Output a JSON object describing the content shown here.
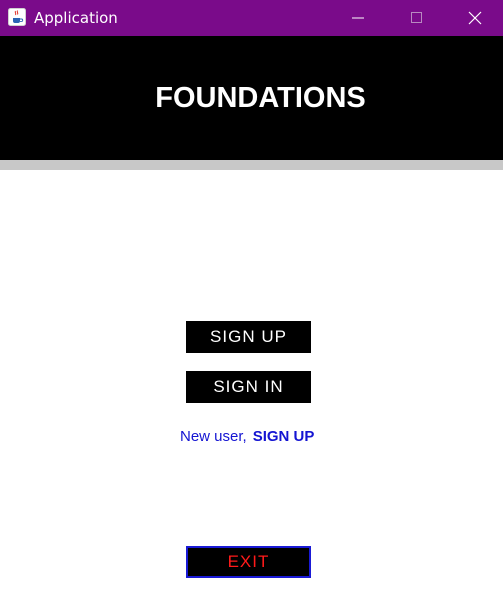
{
  "window": {
    "title": "Application",
    "icon": "java-cup-icon",
    "controls": {
      "minimize": "minimize-icon",
      "maximize": "maximize-icon",
      "close": "close-icon"
    },
    "titlebar_color": "#7a0b8a"
  },
  "header": {
    "title": "FOUNDATIONS",
    "background": "#000000"
  },
  "buttons": {
    "sign_up": "SIGN UP",
    "sign_in": "SIGN IN",
    "exit": "EXIT"
  },
  "new_user": {
    "label": "New user,",
    "link": "SIGN UP",
    "color": "#1414d2"
  },
  "colors": {
    "exit_text": "#ff1a1a",
    "exit_border": "#1a1ad6",
    "separator": "#c8c8c8"
  }
}
